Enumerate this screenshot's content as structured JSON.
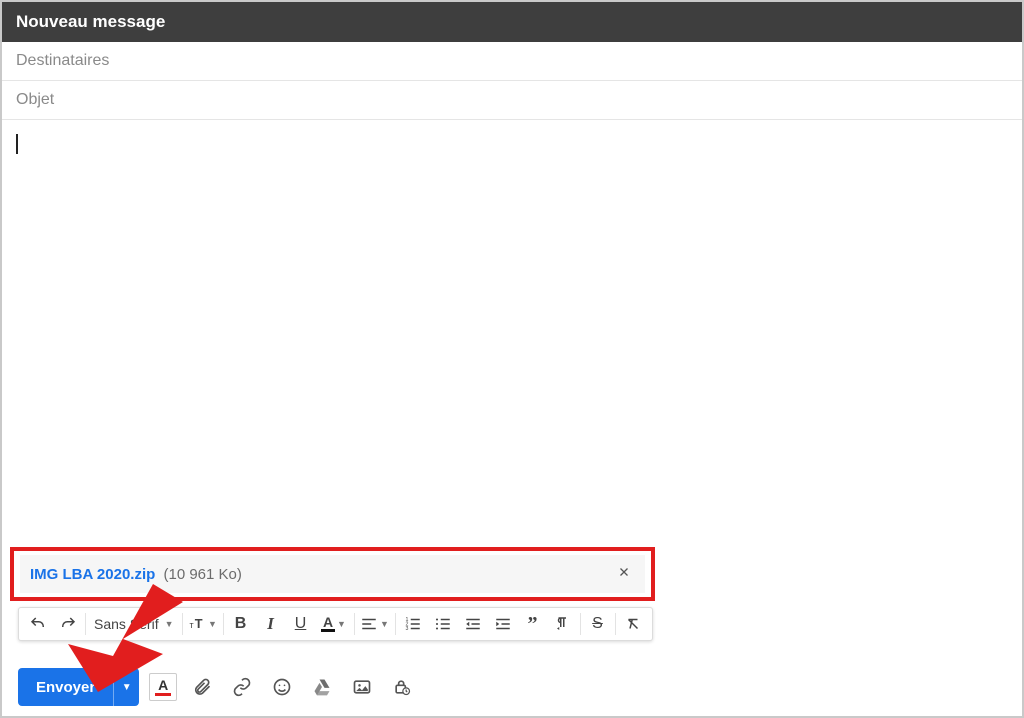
{
  "header": {
    "title": "Nouveau message"
  },
  "fields": {
    "recipients_placeholder": "Destinataires",
    "recipients_value": "",
    "subject_placeholder": "Objet",
    "subject_value": ""
  },
  "body": {
    "content": ""
  },
  "attachment": {
    "file_name": "IMG LBA 2020.zip",
    "file_size": "(10 961 Ko)"
  },
  "format_toolbar": {
    "font_label": "Sans Serif",
    "items": [
      "undo",
      "redo",
      "font",
      "font-size",
      "bold",
      "italic",
      "underline",
      "text-color",
      "align",
      "numbered-list",
      "bulleted-list",
      "indent-decrease",
      "indent-increase",
      "quote",
      "text-direction",
      "strikethrough",
      "clear-formatting"
    ]
  },
  "send": {
    "label": "Envoyer"
  },
  "colors": {
    "accent": "#1a73e8",
    "annotation": "#e11e1e"
  }
}
